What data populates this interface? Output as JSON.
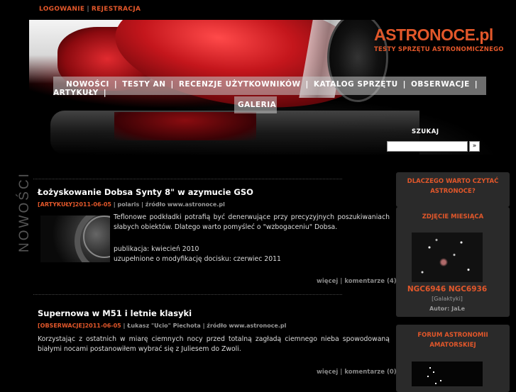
{
  "top": {
    "login": "LOGOWANIE",
    "separator": "|",
    "register": "REJESTRACJA"
  },
  "logo": {
    "name": "ASTRONOCE.pl",
    "tagline": "TESTY SPRZĘTU ASTRONOMICZNEGO"
  },
  "nav": {
    "items": [
      "NOWOŚCI",
      "TESTY AN",
      "RECENZJE UŻYTKOWNIKÓW",
      "KATALOG SPRZĘTU",
      "OBSERWACJE",
      "ARTYKUŁY"
    ],
    "separator": "|",
    "second_row": "GALERIA"
  },
  "search": {
    "label": "SZUKAJ",
    "value": "",
    "button": "»"
  },
  "section_label": "NOWOŚCI",
  "articles": [
    {
      "title": "Łożyskowanie Dobsa Synty 8\" w azymucie GSO",
      "category": "[ARTYKUŁY]",
      "date": "2011-06-05",
      "sep1": " | ",
      "author": "polaris",
      "sep2": " | ",
      "source": "źródło www.astronoce.pl",
      "text": "Teflonowe podkładki potrafią być denerwujące przy precyzyjnych poszukiwaniach słabych obiektów. Dlatego warto pomyśleć o \"wzbogaceniu\" Dobsa.",
      "published": "publikacja: kwiecień 2010",
      "updated": "uzupełnione o modyfikację docisku: czerwiec 2011",
      "more": "więcej",
      "comments": "komentarze (4)"
    },
    {
      "title": "Supernowa w M51 i letnie klasyki",
      "category": "[OBSERWACJE]",
      "date": "2011-06-05",
      "sep1": " | ",
      "author": "Łukasz \"Ucio\" Piechota",
      "sep2": " | ",
      "source": "źródło www.astronoce.pl",
      "text": "Korzystając z ostatnich w miarę ciemnych nocy przed totalną zagładą ciemnego nieba spowodowaną białymi nocami postanowiłem wybrać się z Juliesem do Zwoli.",
      "more": "więcej",
      "comments": "komentarze (0)"
    }
  ],
  "sidebar": {
    "why_read": "DLACZEGO WARTO CZYTAĆ ASTRONOCE?",
    "photo_of_month": "ZDJĘCIE MIESIĄCA",
    "photo_name": "NGC6946 NGC6936",
    "photo_category": "[Galaktyki]",
    "photo_author": "Autor: JaLe",
    "forum": "FORUM ASTRONOMII AMATORSKIEJ"
  }
}
